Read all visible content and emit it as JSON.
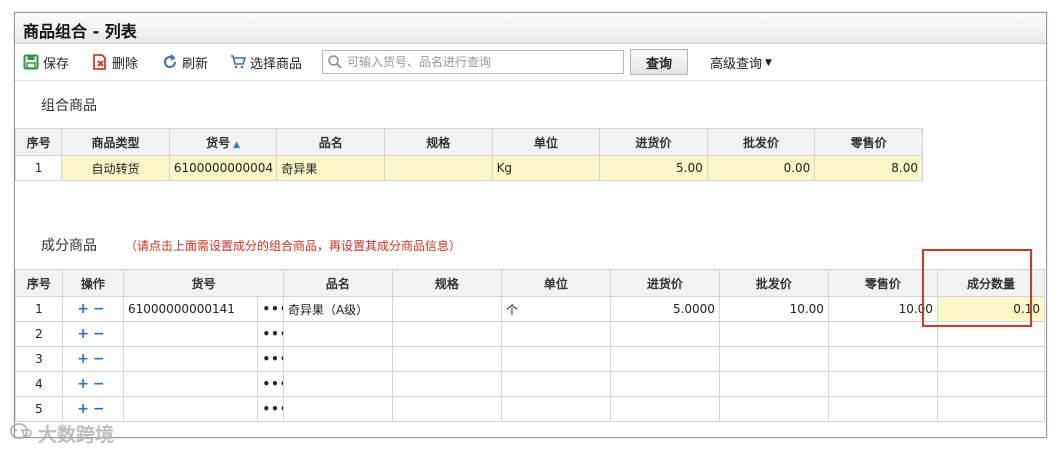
{
  "window": {
    "title": "商品组合 - 列表"
  },
  "toolbar": {
    "save_label": "保存",
    "delete_label": "删除",
    "refresh_label": "刷新",
    "select_label": "选择商品",
    "search_placeholder": "可输入货号、品名进行查询",
    "query_label": "查询",
    "advanced_label": "高级查询"
  },
  "combo": {
    "section_label": "组合商品",
    "columns": [
      "序号",
      "商品类型",
      "货号",
      "品名",
      "规格",
      "单位",
      "进货价",
      "批发价",
      "零售价"
    ],
    "rows": [
      {
        "seq": "1",
        "type": "自动转货",
        "code": "6100000000004",
        "name": "奇异果",
        "spec": "",
        "unit": "Kg",
        "purchase": "5.00",
        "wholesale": "0.00",
        "retail": "8.00"
      }
    ]
  },
  "component": {
    "section_label": "成分商品",
    "hint": "（请点击上面需设置成分的组合商品，再设置其成分商品信息）",
    "columns": [
      "序号",
      "操作",
      "货号",
      "",
      "品名",
      "规格",
      "单位",
      "进货价",
      "批发价",
      "零售价",
      "成分数量"
    ],
    "rows": [
      {
        "seq": "1",
        "code": "61000000000141",
        "name": "奇异果（A级）",
        "spec": "",
        "unit": "个",
        "purchase": "5.0000",
        "wholesale": "10.00",
        "retail": "10.00",
        "qty": "0.10"
      },
      {
        "seq": "2",
        "code": "",
        "name": "",
        "spec": "",
        "unit": "",
        "purchase": "",
        "wholesale": "",
        "retail": "",
        "qty": ""
      },
      {
        "seq": "3",
        "code": "",
        "name": "",
        "spec": "",
        "unit": "",
        "purchase": "",
        "wholesale": "",
        "retail": "",
        "qty": ""
      },
      {
        "seq": "4",
        "code": "",
        "name": "",
        "spec": "",
        "unit": "",
        "purchase": "",
        "wholesale": "",
        "retail": "",
        "qty": ""
      },
      {
        "seq": "5",
        "code": "",
        "name": "",
        "spec": "",
        "unit": "",
        "purchase": "",
        "wholesale": "",
        "retail": "",
        "qty": ""
      }
    ],
    "plus_symbol": "+",
    "minus_symbol": "−",
    "more_symbol": "•••"
  },
  "watermark": {
    "text": "大数跨境"
  },
  "colors": {
    "accent_blue": "#2c73c8",
    "highlight_yellow": "#faf7c8",
    "hint_red": "#d03020",
    "redbox": "#d8352a",
    "save_green": "#2f9a3a",
    "delete_red": "#d23a2a"
  }
}
